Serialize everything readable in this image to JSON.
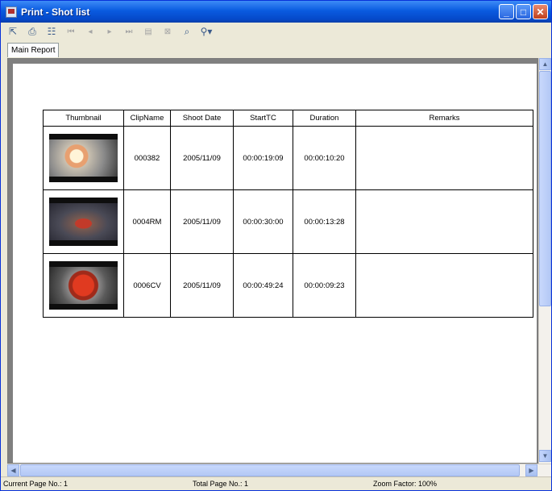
{
  "window": {
    "title": "Print - Shot list"
  },
  "toolbar": {
    "tools": [
      "export-icon",
      "print-icon",
      "group-tree-icon",
      "first-page-icon",
      "previous-page-icon",
      "next-page-icon",
      "last-page-icon",
      "goto-page-icon",
      "stop-icon",
      "search-icon",
      "zoom-icon"
    ]
  },
  "tab": {
    "label": "Main Report"
  },
  "table": {
    "headers": [
      "Thumbnail",
      "ClipName",
      "Shoot Date",
      "StartTC",
      "Duration",
      "Remarks"
    ],
    "rows": [
      {
        "clip": "000382",
        "date": "2005/11/09",
        "start": "00:00:19:09",
        "duration": "00:00:10:20",
        "remarks": ""
      },
      {
        "clip": "0004RM",
        "date": "2005/11/09",
        "start": "00:00:30:00",
        "duration": "00:00:13:28",
        "remarks": ""
      },
      {
        "clip": "0006CV",
        "date": "2005/11/09",
        "start": "00:00:49:24",
        "duration": "00:00:09:23",
        "remarks": ""
      }
    ]
  },
  "status": {
    "current_page": "Current Page No.: 1",
    "total_page": "Total Page No.: 1",
    "zoom": "Zoom Factor: 100%"
  }
}
